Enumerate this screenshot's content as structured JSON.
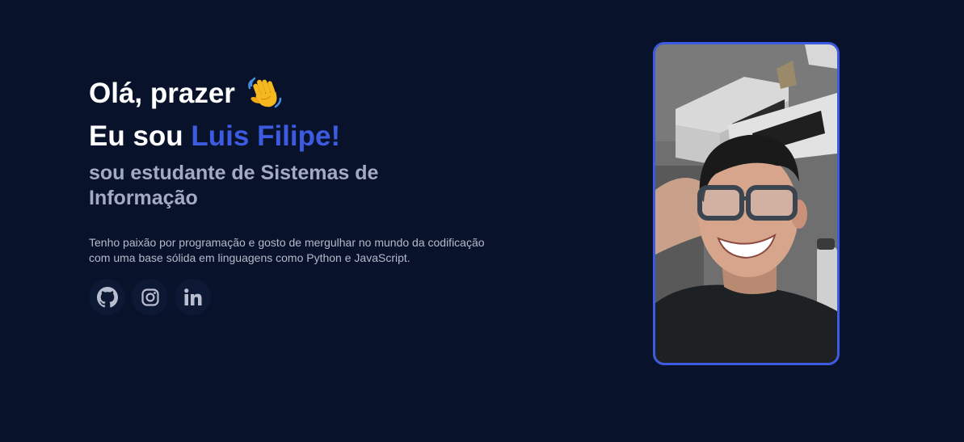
{
  "hero": {
    "greeting": "Olá, prazer",
    "wave_icon": "waving-hand-emoji",
    "headline_prefix": "Eu sou ",
    "name": "Luis Filipe!",
    "subtitle": "sou estudante de Sistemas de Informação",
    "bio": "Tenho paixão por programação e gosto de mergulhar no mundo da codificação com uma base sólida em linguagens como Python e JavaScript."
  },
  "socials": [
    {
      "icon": "github-icon"
    },
    {
      "icon": "instagram-icon"
    },
    {
      "icon": "linkedin-icon"
    }
  ],
  "photo": {
    "subject": "profile-photo"
  },
  "colors": {
    "background": "#08132b",
    "accent": "#3d5be0",
    "heading": "#ffffff",
    "subtitle": "#a3abc0",
    "body_text": "#b4bac9",
    "icon": "#b8bdd0"
  }
}
